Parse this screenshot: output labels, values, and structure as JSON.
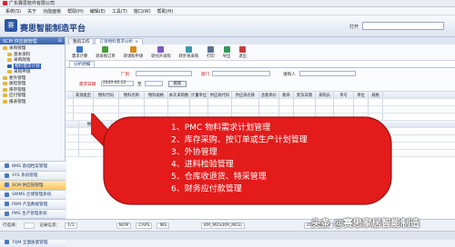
{
  "window": {
    "title": "广东赛思软件有限公司"
  },
  "menu": [
    "系统(S)",
    "关于",
    "功能面板",
    "帮助(H)",
    "编辑(E)",
    "工具(T)",
    "窗口(W)",
    "帮助(H)"
  ],
  "banner": {
    "logo_text": "赛",
    "brand": "赛思智能制造平台",
    "search_label": "打开",
    "search_value": ""
  },
  "sidebar": {
    "header": "SCM 供应链管理",
    "header_icon": "pin-icon",
    "tree": [
      {
        "label": "采购管理",
        "level": 1
      },
      {
        "label": "基本资料",
        "level": 2
      },
      {
        "label": "采购政策",
        "level": 2
      },
      {
        "label": "物料需求计划",
        "level": 2,
        "selected": true
      },
      {
        "label": "采购申请",
        "level": 2
      },
      {
        "label": "委外管理",
        "level": 1
      },
      {
        "label": "质检管理",
        "level": 1
      },
      {
        "label": "库存管理",
        "level": 1
      },
      {
        "label": "应付管理",
        "level": 1
      },
      {
        "label": "报表管理",
        "level": 1
      }
    ],
    "modules": [
      {
        "label": "BMS 基础档案管理",
        "active": false
      },
      {
        "label": "SYS 系统管理",
        "active": false
      },
      {
        "label": "SCM 供应链管理",
        "active": true
      },
      {
        "label": "SWMS 仓储管理系统",
        "active": false
      },
      {
        "label": "PDM 产品数据管理",
        "active": false
      },
      {
        "label": "PMS 生产管理系统",
        "active": false
      },
      {
        "label": "MES 制造执行系统",
        "active": false
      },
      {
        "label": "APS 智能排程系统",
        "active": false
      },
      {
        "label": "TQM 全面质量管理",
        "active": false
      }
    ]
  },
  "tabs": [
    {
      "label": "我的工作",
      "active": false
    },
    {
      "label": "订单物料需求分析",
      "active": true
    }
  ],
  "toolbar": [
    {
      "label": "需求计算",
      "icon": "calculate-icon",
      "color": "#3a78c9"
    },
    {
      "label": "转采购订单",
      "icon": "purchase-order-icon",
      "color": "#4a9a3a"
    },
    {
      "label": "转请购申请",
      "icon": "request-icon",
      "color": "#d98a1f"
    },
    {
      "label": "转托外采购",
      "icon": "outsource-icon",
      "color": "#7a5bbf"
    },
    {
      "label": "转外协采购",
      "icon": "cooperate-icon",
      "color": "#3a9ab0"
    },
    {
      "label": "打印",
      "icon": "print-icon",
      "color": "#5b6f8f"
    },
    {
      "label": "导出",
      "icon": "export-icon",
      "color": "#2f9a5a"
    },
    {
      "label": "退出",
      "icon": "exit-icon",
      "color": "#c93a3a"
    }
  ],
  "subtab": "分析明细",
  "form": {
    "factory_label": "厂别",
    "factory_value": "",
    "dept_label": "部门",
    "dept_value": "",
    "buyer_label": "请购人",
    "buyer_value": "",
    "date_label": "需求日期",
    "date_value": "2020-02-22",
    "date_to": "至",
    "refresh_button": "刷新"
  },
  "grid": {
    "headers": [
      "",
      "来源类型",
      "物料代码",
      "物料名称",
      "物料规格",
      "本次采购数",
      "计量单位",
      "供应商代码",
      "供应商名称",
      "含税单价",
      "税率",
      "到货日期",
      "采购员",
      "单号",
      "单位",
      "规格"
    ],
    "second_headers": [
      "",
      "物料代码",
      "物料名称",
      "物料规格",
      "需求数量",
      "库存数量",
      "在途数量",
      "可用数量",
      "计划数量",
      "单位"
    ]
  },
  "callout": {
    "items": [
      "1、PMC 物料需求计划管理",
      "2、库存采购、按订单或生产计划管理",
      "3、外协管理",
      "4、进料检验管理",
      "5、仓库收退货、特采管理",
      "6、财务应付款管理"
    ],
    "fill": "#e31b1b",
    "stroke": "#9a1010"
  },
  "status": {
    "label1": "行选择：",
    "label2": "记录信息：",
    "record": "1/1",
    "keys": [
      "NUM",
      "CAPS",
      "INS"
    ],
    "server": "KM_MES(KM_MES)",
    "date": "2020/02/22"
  },
  "watermark": "头条 @赛思家居智能制造"
}
